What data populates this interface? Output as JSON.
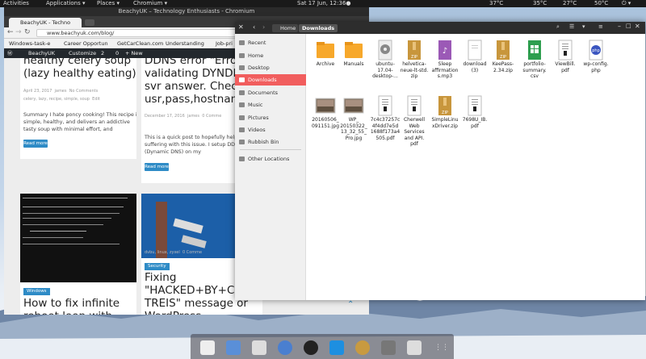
{
  "topbar": {
    "activities": "Activities",
    "applications": "Applications ▾",
    "places": "Places ▾",
    "chromium": "Chromium ▾",
    "clock": "Sat 17 Jun, 12:36●",
    "temp1": "37°C",
    "temp2": "35°C",
    "temp3": "27°C",
    "temp4": "50°C"
  },
  "chrome": {
    "window_title": "BeachyUK – Technology Enthusiasts - Chromium",
    "tab1": "BeachyUK - Techno",
    "url": "www.beachyuk.com/blog/",
    "bookmarks": [
      "Windows-task-e",
      "Career Opportun",
      "GetCarClean.com",
      "Understanding",
      "Job-pri"
    ],
    "wp": {
      "site": "BeachyUK",
      "customize": "Customize",
      "updates": "2",
      "comments": "0",
      "new": "+ New"
    },
    "posts": [
      {
        "title": "healthy celery soup\n(lazy healthy eating)",
        "date": "April 23, 2017",
        "author": "james",
        "comments": "No Comments",
        "tags": "celery, lazy, recipe, simple, soup",
        "edit": "Edit",
        "excerpt": "Summary I hate poncy cooking! This recipe is\nsimple, healthy, and delivers an addictive\ntasty soup with minimal effort, and",
        "readmore": "Read more"
      },
      {
        "title": "DDNS error \"Error\nvalidating DYNDNS\nsvr answer. Check\nusr,pass,hostname",
        "date": "December 17, 2016",
        "author": "james",
        "comments": "0 Comme",
        "excerpt": "This is a quick post to hopefully help ot\nsuffering with this issue. I setup DDNS\n(Dynamic DNS) on my",
        "readmore": "Read more"
      },
      {
        "category": "Windows",
        "title": "How to fix infinite\nreboot loop with"
      },
      {
        "category": "Security",
        "title": "Fixing\n\"HACKED+BY+CELI\nTREIS\" message or\nWordPress",
        "tags": "dvbu, linux, zyxel",
        "comments": "0 Comme"
      }
    ]
  },
  "files": {
    "path_home": "Home",
    "path_current": "Downloads",
    "sidebar": [
      "Recent",
      "Home",
      "Desktop",
      "Downloads",
      "Documents",
      "Music",
      "Pictures",
      "Videos",
      "Rubbish Bin",
      "Other Locations"
    ],
    "items": [
      {
        "name": "Archive",
        "icon": "folder-icon"
      },
      {
        "name": "Manuals",
        "icon": "folder-icon"
      },
      {
        "name": "ubuntu-\n17.04-\ndesktop-...",
        "icon": "disc-image-icon"
      },
      {
        "name": "helvetica-\nneue-lt-std.\nzip",
        "icon": "zip-icon"
      },
      {
        "name": "Sleep\naffirmation\ns.mp3",
        "icon": "audio-icon"
      },
      {
        "name": "download\n(3)",
        "icon": "file-icon"
      },
      {
        "name": "KeePass-\n2.34.zip",
        "icon": "zip-icon"
      },
      {
        "name": "portfolio-\nsummary.\ncsv",
        "icon": "spreadsheet-icon"
      },
      {
        "name": "ViewBill.\npdf",
        "icon": "pdf-icon"
      },
      {
        "name": "wp-config.\nphp",
        "icon": "php-icon"
      },
      {
        "name": "20160506_\n091151.jpg",
        "icon": "image-icon"
      },
      {
        "name": "WP_\n20150322_\n13_32_55_\nPro.jpg",
        "icon": "image-icon"
      },
      {
        "name": "7c4c37257c\n4f4dd7e5d\n1688f173a4\n505.pdf",
        "icon": "pdf-icon"
      },
      {
        "name": "Cherwell\nWeb\nServices\nand API.\npdf",
        "icon": "pdf-icon"
      },
      {
        "name": "SimpleLinu\nxDriver.zip",
        "icon": "zip-icon"
      },
      {
        "name": "7698U_IB.\npdf",
        "icon": "pdf-icon"
      }
    ]
  },
  "colors": {
    "accent": "#f15e5e",
    "wpblue": "#2e8bc6",
    "folder": "#f7a82b"
  }
}
